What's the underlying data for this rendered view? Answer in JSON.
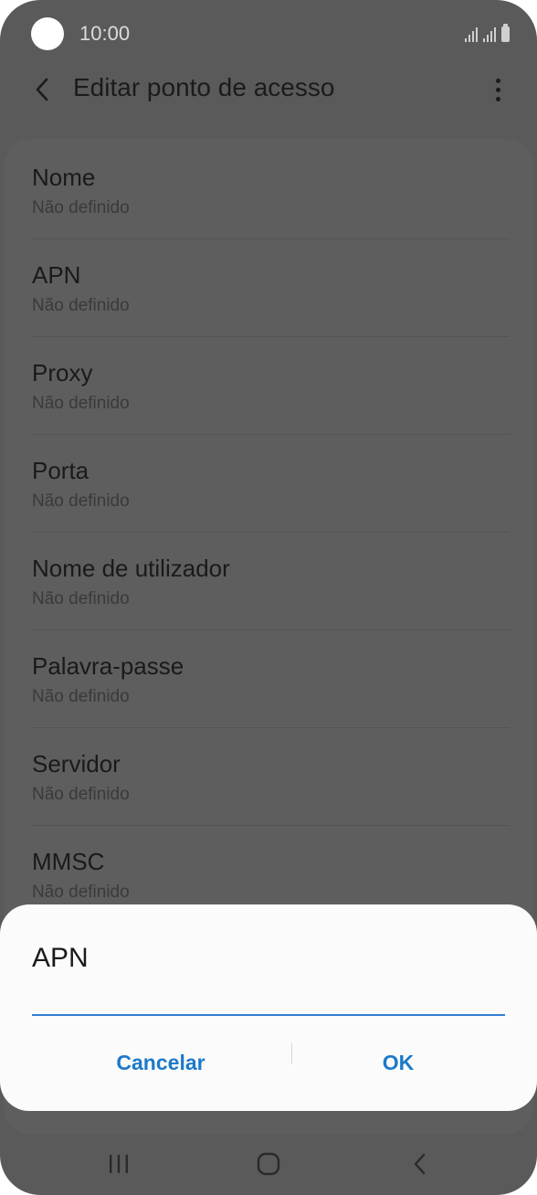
{
  "status_bar": {
    "time": "10:00",
    "icons": [
      "signal-icon",
      "signal-icon",
      "battery-icon"
    ]
  },
  "app_bar": {
    "title": "Editar ponto de acesso",
    "back_icon": "chevron-left-icon",
    "more_icon": "more-vertical-icon"
  },
  "settings": {
    "items": [
      {
        "label": "Nome",
        "value": "Não definido"
      },
      {
        "label": "APN",
        "value": "Não definido"
      },
      {
        "label": "Proxy",
        "value": "Não definido"
      },
      {
        "label": "Porta",
        "value": "Não definido"
      },
      {
        "label": "Nome de utilizador",
        "value": "Não definido"
      },
      {
        "label": "Palavra-passe",
        "value": "Não definido"
      },
      {
        "label": "Servidor",
        "value": "Não definido"
      },
      {
        "label": "MMSC",
        "value": "Não definido"
      }
    ]
  },
  "dialog": {
    "title": "APN",
    "input_value": "",
    "cancel_label": "Cancelar",
    "ok_label": "OK",
    "accent_color": "#1c79c8"
  },
  "nav_bar": {
    "icons": [
      "recents-icon",
      "home-icon",
      "back-icon"
    ]
  }
}
